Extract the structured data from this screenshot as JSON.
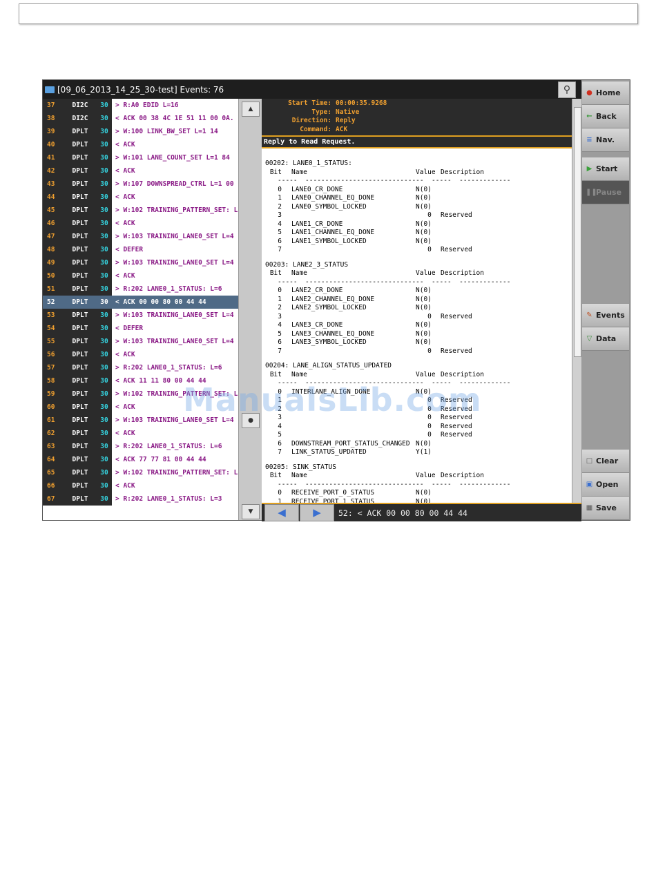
{
  "window": {
    "title": "[09_06_2013_14_25_30-test] Events: 76"
  },
  "events": [
    {
      "num": "37",
      "type": "DI2C",
      "ch": "30",
      "desc": "> R:A0 EDID L=16"
    },
    {
      "num": "38",
      "type": "DI2C",
      "ch": "30",
      "desc": "< ACK 00 38 4C 1E 51 11 00 0A."
    },
    {
      "num": "39",
      "type": "DPLT",
      "ch": "30",
      "desc": "> W:100 LINK_BW_SET L=1 14"
    },
    {
      "num": "40",
      "type": "DPLT",
      "ch": "30",
      "desc": "< ACK"
    },
    {
      "num": "41",
      "type": "DPLT",
      "ch": "30",
      "desc": "> W:101 LANE_COUNT_SET L=1 84"
    },
    {
      "num": "42",
      "type": "DPLT",
      "ch": "30",
      "desc": "< ACK"
    },
    {
      "num": "43",
      "type": "DPLT",
      "ch": "30",
      "desc": "> W:107 DOWNSPREAD_CTRL L=1 00"
    },
    {
      "num": "44",
      "type": "DPLT",
      "ch": "30",
      "desc": "< ACK"
    },
    {
      "num": "45",
      "type": "DPLT",
      "ch": "30",
      "desc": "> W:102 TRAINING_PATTERN_SET: L"
    },
    {
      "num": "46",
      "type": "DPLT",
      "ch": "30",
      "desc": "< ACK"
    },
    {
      "num": "47",
      "type": "DPLT",
      "ch": "30",
      "desc": "> W:103 TRAINING_LANE0_SET L=4"
    },
    {
      "num": "48",
      "type": "DPLT",
      "ch": "30",
      "desc": "< DEFER"
    },
    {
      "num": "49",
      "type": "DPLT",
      "ch": "30",
      "desc": "> W:103 TRAINING_LANE0_SET L=4"
    },
    {
      "num": "50",
      "type": "DPLT",
      "ch": "30",
      "desc": "< ACK"
    },
    {
      "num": "51",
      "type": "DPLT",
      "ch": "30",
      "desc": "> R:202 LANE0_1_STATUS: L=6"
    },
    {
      "num": "52",
      "type": "DPLT",
      "ch": "30",
      "desc": "< ACK 00 00 80 00 44 44",
      "selected": true
    },
    {
      "num": "53",
      "type": "DPLT",
      "ch": "30",
      "desc": "> W:103 TRAINING_LANE0_SET L=4"
    },
    {
      "num": "54",
      "type": "DPLT",
      "ch": "30",
      "desc": "< DEFER"
    },
    {
      "num": "55",
      "type": "DPLT",
      "ch": "30",
      "desc": "> W:103 TRAINING_LANE0_SET L=4"
    },
    {
      "num": "56",
      "type": "DPLT",
      "ch": "30",
      "desc": "< ACK"
    },
    {
      "num": "57",
      "type": "DPLT",
      "ch": "30",
      "desc": "> R:202 LANE0_1_STATUS: L=6"
    },
    {
      "num": "58",
      "type": "DPLT",
      "ch": "30",
      "desc": "< ACK 11 11 80 00 44 44"
    },
    {
      "num": "59",
      "type": "DPLT",
      "ch": "30",
      "desc": "> W:102 TRAINING_PATTERN_SET: L"
    },
    {
      "num": "60",
      "type": "DPLT",
      "ch": "30",
      "desc": "< ACK"
    },
    {
      "num": "61",
      "type": "DPLT",
      "ch": "30",
      "desc": "> W:103 TRAINING_LANE0_SET L=4"
    },
    {
      "num": "62",
      "type": "DPLT",
      "ch": "30",
      "desc": "< ACK"
    },
    {
      "num": "63",
      "type": "DPLT",
      "ch": "30",
      "desc": "> R:202 LANE0_1_STATUS: L=6"
    },
    {
      "num": "64",
      "type": "DPLT",
      "ch": "30",
      "desc": "< ACK 77 77 81 00 44 44"
    },
    {
      "num": "65",
      "type": "DPLT",
      "ch": "30",
      "desc": "> W:102 TRAINING_PATTERN_SET: L"
    },
    {
      "num": "66",
      "type": "DPLT",
      "ch": "30",
      "desc": "< ACK"
    },
    {
      "num": "67",
      "type": "DPLT",
      "ch": "30",
      "desc": "> R:202 LANE0_1_STATUS: L=3"
    }
  ],
  "detail": {
    "header": [
      {
        "key": "Start Time:",
        "value": "00:00:35.9268"
      },
      {
        "key": "Type:",
        "value": "Native"
      },
      {
        "key": "Direction:",
        "value": "Reply"
      },
      {
        "key": "Command:",
        "value": "ACK"
      }
    ],
    "reply_text": "Reply to Read Request.",
    "columns": {
      "bit": "Bit",
      "name": "Name",
      "value": "Value",
      "desc": "Description"
    },
    "dash_line": "-----  ------------------------------  -----  -------------",
    "registers": [
      {
        "title": "00202: LANE0_1_STATUS:",
        "bits": [
          {
            "bit": "0",
            "name": "LANE0_CR_DONE",
            "value": "N(0)",
            "desc": ""
          },
          {
            "bit": "1",
            "name": "LANE0_CHANNEL_EQ_DONE",
            "value": "N(0)",
            "desc": ""
          },
          {
            "bit": "2",
            "name": "LANE0_SYMBOL_LOCKED",
            "value": "N(0)",
            "desc": ""
          },
          {
            "bit": "3",
            "name": "",
            "value": "   0",
            "desc": "Reserved"
          },
          {
            "bit": "4",
            "name": "LANE1_CR_DONE",
            "value": "N(0)",
            "desc": ""
          },
          {
            "bit": "5",
            "name": "LANE1_CHANNEL_EQ_DONE",
            "value": "N(0)",
            "desc": ""
          },
          {
            "bit": "6",
            "name": "LANE1_SYMBOL_LOCKED",
            "value": "N(0)",
            "desc": ""
          },
          {
            "bit": "7",
            "name": "",
            "value": "   0",
            "desc": "Reserved"
          }
        ]
      },
      {
        "title": "00203: LANE2_3_STATUS",
        "bits": [
          {
            "bit": "0",
            "name": "LANE2_CR_DONE",
            "value": "N(0)",
            "desc": ""
          },
          {
            "bit": "1",
            "name": "LANE2_CHANNEL_EQ_DONE",
            "value": "N(0)",
            "desc": ""
          },
          {
            "bit": "2",
            "name": "LANE2_SYMBOL_LOCKED",
            "value": "N(0)",
            "desc": ""
          },
          {
            "bit": "3",
            "name": "",
            "value": "   0",
            "desc": "Reserved"
          },
          {
            "bit": "4",
            "name": "LANE3_CR_DONE",
            "value": "N(0)",
            "desc": ""
          },
          {
            "bit": "5",
            "name": "LANE3_CHANNEL_EQ_DONE",
            "value": "N(0)",
            "desc": ""
          },
          {
            "bit": "6",
            "name": "LANE3_SYMBOL_LOCKED",
            "value": "N(0)",
            "desc": ""
          },
          {
            "bit": "7",
            "name": "",
            "value": "   0",
            "desc": "Reserved"
          }
        ]
      },
      {
        "title": "00204: LANE_ALIGN_STATUS_UPDATED",
        "bits": [
          {
            "bit": "0",
            "name": "INTERLANE_ALIGN_DONE",
            "value": "N(0)",
            "desc": ""
          },
          {
            "bit": "1",
            "name": "",
            "value": "   0",
            "desc": "Reserved"
          },
          {
            "bit": "2",
            "name": "",
            "value": "   0",
            "desc": "Reserved"
          },
          {
            "bit": "3",
            "name": "",
            "value": "   0",
            "desc": "Reserved"
          },
          {
            "bit": "4",
            "name": "",
            "value": "   0",
            "desc": "Reserved"
          },
          {
            "bit": "5",
            "name": "",
            "value": "   0",
            "desc": "Reserved"
          },
          {
            "bit": "6",
            "name": "DOWNSTREAM_PORT_STATUS_CHANGED",
            "value": "N(0)",
            "desc": ""
          },
          {
            "bit": "7",
            "name": "LINK_STATUS_UPDATED",
            "value": "Y(1)",
            "desc": ""
          }
        ]
      },
      {
        "title": "00205: SINK_STATUS",
        "bits": [
          {
            "bit": "0",
            "name": "RECEIVE_PORT_0_STATUS",
            "value": "N(0)",
            "desc": ""
          },
          {
            "bit": "1",
            "name": "RECEIVE_PORT_1_STATUS",
            "value": "N(0)",
            "desc": ""
          }
        ]
      }
    ]
  },
  "nav": {
    "prev": "◀",
    "next": "▶",
    "status": "52: < ACK 00 00 80 00 44 44"
  },
  "sidebar": {
    "home": "Home",
    "back": "Back",
    "nav": "Nav.",
    "start": "Start",
    "pause": "Pause",
    "events": "Events",
    "data": "Data",
    "clear": "Clear",
    "open": "Open",
    "save": "Save"
  },
  "watermark": "ManualsLib.com",
  "colors": {
    "number": "#f0a030",
    "channel": "#35d4e0",
    "description": "#8a1a86",
    "selected_row": "#4f6a86",
    "accent": "#e0a020"
  }
}
